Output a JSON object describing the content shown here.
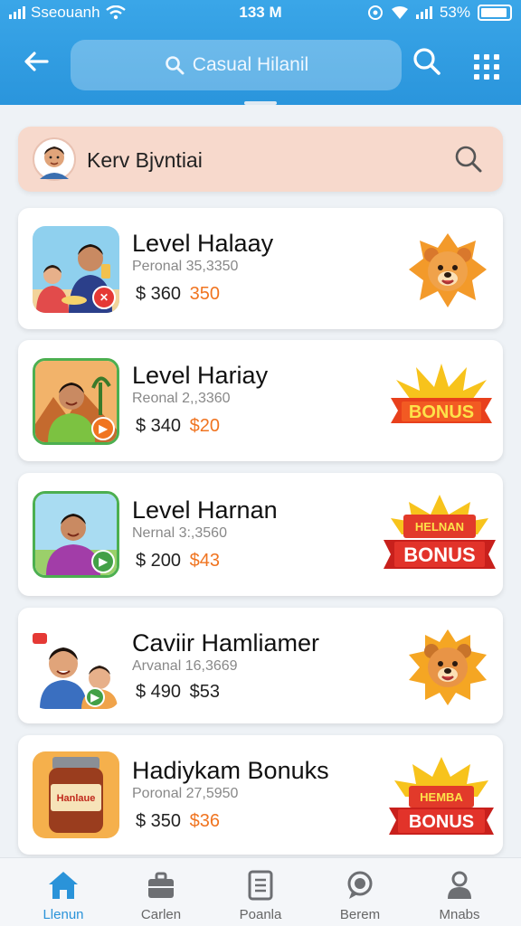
{
  "status_bar": {
    "carrier": "Sseouanh",
    "time": "133 M",
    "battery": "53%"
  },
  "header": {
    "search_text": "Casual Hilanil"
  },
  "search_card": {
    "query": "Kerv Bjvntiai"
  },
  "items": [
    {
      "title": "Level Halaay",
      "subtitle": "Peronal 35,3350",
      "price_old": "$ 360",
      "price_new": "350",
      "reward": "bear-sun",
      "thumb": "father-child",
      "thumb_badge": "red"
    },
    {
      "title": "Level Hariay",
      "subtitle": "Reonal 2,,3360",
      "price_old": "$ 340",
      "price_new": "$20",
      "reward": "bonus",
      "reward_text": "BONUS",
      "thumb": "man-desert",
      "thumb_badge": "orange"
    },
    {
      "title": "Level Harnan",
      "subtitle": "Nernal 3:,3560",
      "price_old": "$ 200",
      "price_new": "$43",
      "reward": "bonus-banner",
      "reward_text_top": "HELNAN",
      "reward_text": "BONUS",
      "thumb": "man-purple",
      "thumb_badge": "green"
    },
    {
      "title": "Caviir Hamliamer",
      "subtitle": "Arvanal 16,3669",
      "price_old": "$ 490",
      "price_new": "$53",
      "reward": "bear-sun",
      "thumb": "two-kids",
      "thumb_badge": "green"
    },
    {
      "title": "Hadiykam Bonuks",
      "subtitle": "Poronal 27,5950",
      "price_old": "$ 350",
      "price_new": "$36",
      "reward": "bonus-banner",
      "reward_text_top": "HEMBA",
      "reward_text": "BONUS",
      "thumb": "jar",
      "thumb_badge": "none",
      "thumb_label": "Hanlaue"
    }
  ],
  "bottom_nav": [
    {
      "label": "Llenun",
      "icon": "home-icon",
      "active": true
    },
    {
      "label": "Carlen",
      "icon": "briefcase-icon",
      "active": false
    },
    {
      "label": "Poanla",
      "icon": "document-icon",
      "active": false
    },
    {
      "label": "Berem",
      "icon": "chat-icon",
      "active": false
    },
    {
      "label": "Mnabs",
      "icon": "profile-icon",
      "active": false
    }
  ],
  "colors": {
    "header": "#2a95dc",
    "accent_price": "#f07420",
    "active_nav": "#2a93d9",
    "search_card": "#f7d9cc"
  }
}
